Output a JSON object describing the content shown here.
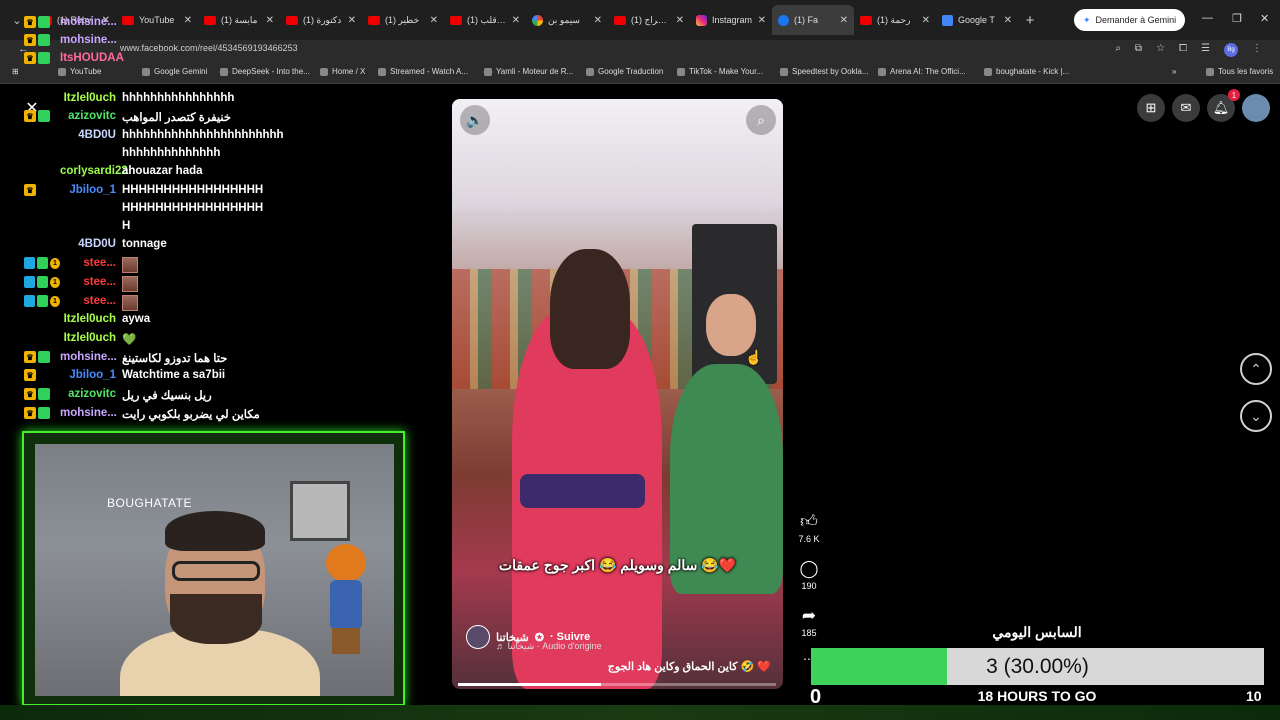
{
  "browser": {
    "tabs": [
      {
        "title": "(1) Ruby",
        "fav": "yt"
      },
      {
        "title": "YouTube",
        "fav": "yt"
      },
      {
        "title": "(1) مايسة",
        "fav": "yt"
      },
      {
        "title": "(1) دكتورة",
        "fav": "yt"
      },
      {
        "title": "(1) خطير",
        "fav": "yt"
      },
      {
        "title": "(1) من قلب",
        "fav": "yt"
      },
      {
        "title": "سيمو بن",
        "fav": "g"
      },
      {
        "title": "(1) الإخراج",
        "fav": "yt"
      },
      {
        "title": "Instagram",
        "fav": "ig"
      },
      {
        "title": "(1) Fa",
        "fav": "fb",
        "active": true
      },
      {
        "title": "(1) رحمة",
        "fav": "yt"
      },
      {
        "title": "Google T",
        "fav": "gt"
      }
    ],
    "gemini_label": "Demander à Gemini",
    "url": "www.facebook.com/reel/4534569193466253",
    "profile_initials": "Bg",
    "bookmarks": [
      "YouTube",
      "Google Gemini",
      "DeepSeek - Into the...",
      "Home / X",
      "Streamed - Watch A...",
      "Yamli - Moteur de R...",
      "Google Traduction",
      "TikTok - Make Your...",
      "Speedtest by Ookla...",
      "Arena AI: The Offici...",
      "boughatate - Kick |..."
    ],
    "all_bookmarks": "Tous les favoris"
  },
  "chat": [
    {
      "user": "mohsine...",
      "color": "#c9a5ff",
      "text": "",
      "badges": [
        "crown",
        "green"
      ]
    },
    {
      "user": "mohsine...",
      "color": "#c9a5ff",
      "text": "",
      "badges": [
        "crown",
        "green"
      ]
    },
    {
      "user": "ItsHOUDAA",
      "color": "#ff6b9a",
      "text": "",
      "badges": [
        "crown",
        "green"
      ]
    },
    {
      "user": "Itzlel0uch",
      "color": "#a9ff4a",
      "text": "hhhhhhhhhhhhhhhh",
      "badges": []
    },
    {
      "user": "azizovitc",
      "color": "#52e56a",
      "text": "خنيفرة كتصدر المواهب",
      "badges": [
        "crown",
        "green"
      ]
    },
    {
      "user": "4BD0U",
      "color": "#c8d6ff",
      "text": "hhhhhhhhhhhhhhhhhhhhhhh",
      "badges": []
    },
    {
      "user": "",
      "color": "#fff",
      "text": "hhhhhhhhhhhhhh",
      "badges": []
    },
    {
      "user": "corlysardi22",
      "color": "#9cff4a",
      "text": "ahouazar hada",
      "badges": []
    },
    {
      "user": "Jbiloo_1",
      "color": "#4a8cff",
      "text": "HHHHHHHHHHHHHHHHH",
      "badges": [
        "crown"
      ]
    },
    {
      "user": "",
      "color": "#fff",
      "text": "HHHHHHHHHHHHHHHHH",
      "badges": []
    },
    {
      "user": "",
      "color": "#fff",
      "text": "H",
      "badges": []
    },
    {
      "user": "4BD0U",
      "color": "#c8d6ff",
      "text": "tonnage",
      "badges": []
    },
    {
      "user": "stee...",
      "color": "#ff3a3a",
      "text": "",
      "badges": [
        "blue",
        "green",
        "gold"
      ],
      "emote": true
    },
    {
      "user": "stee...",
      "color": "#ff3a3a",
      "text": "",
      "badges": [
        "blue",
        "green",
        "gold"
      ],
      "emote": true
    },
    {
      "user": "stee...",
      "color": "#ff3a3a",
      "text": "",
      "badges": [
        "blue",
        "green",
        "gold"
      ],
      "emote": true
    },
    {
      "user": "Itzlel0uch",
      "color": "#a9ff4a",
      "text": "aywa",
      "badges": []
    },
    {
      "user": "Itzlel0uch",
      "color": "#a9ff4a",
      "text": "💚",
      "badges": []
    },
    {
      "user": "mohsine...",
      "color": "#c9a5ff",
      "text": "حتا هما تدوزو لكاستينغ",
      "badges": [
        "crown",
        "green"
      ]
    },
    {
      "user": "Jbiloo_1",
      "color": "#4a8cff",
      "text": "Watchtime a sa7bii",
      "badges": [
        "crown"
      ]
    },
    {
      "user": "azizovitc",
      "color": "#52e56a",
      "text": "ريل بنسيك في ريل",
      "badges": [
        "crown",
        "green"
      ]
    },
    {
      "user": "mohsine...",
      "color": "#c9a5ff",
      "text": "مكاين لي يضربو بلكوبي رايت",
      "badges": [
        "crown",
        "green"
      ]
    }
  ],
  "webcam": {
    "sign": "BOUGHATATE"
  },
  "reel": {
    "caption": "سالم وسويلم 😂 اكبر جوج عمقات 😂❤️",
    "author": "شيخاتنا",
    "follow": "· Suivre",
    "audio": "♬ شيخاتنا · Audio d'origine",
    "description": "كاين الحماق وكاين هاد الجوج 🤣 ❤️",
    "progress": 0.45,
    "likes": "7.6 K",
    "comments": "190",
    "shares": "185"
  },
  "subs_goal": {
    "title": "السابس اليومي",
    "current": 3,
    "target": 10,
    "min": 0,
    "percent_label": "3 (30.00%)",
    "fraction": 0.3,
    "remaining": "18 HOURS TO GO",
    "fill_color": "#3ed25a"
  },
  "fb": {
    "notif_count": "1"
  }
}
